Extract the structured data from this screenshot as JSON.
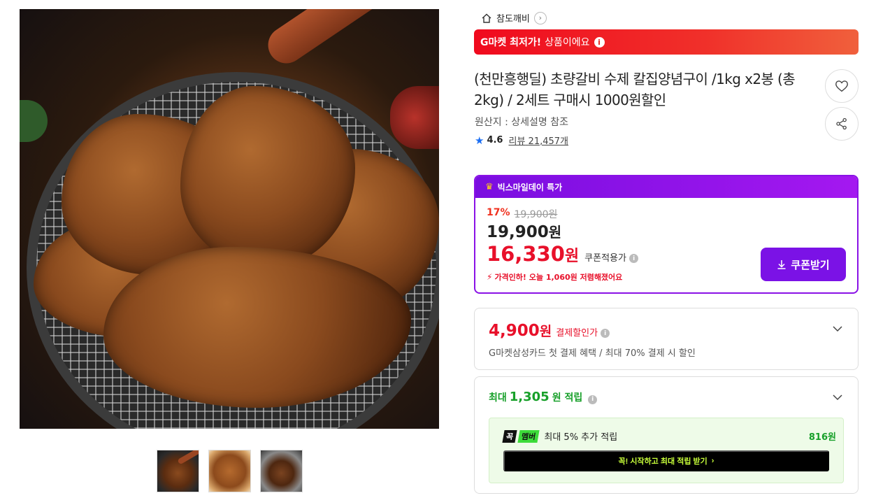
{
  "gallery": {
    "main_image_alt": "양념 소갈비구이 상품 이미지",
    "thumbnails": [
      "thumbnail-1",
      "thumbnail-2",
      "thumbnail-3"
    ]
  },
  "store": {
    "name": "참도깨비"
  },
  "banner": {
    "bold": "G마켓 최저가!",
    "rest": "상품이에요"
  },
  "product": {
    "title": "(천만흥행딜) 초량갈비 수제 칼집양념구이 /1kg x2봉 (총2kg) / 2세트 구매시 1000원할인",
    "origin": "원산지 : 상세설명 참조",
    "rating": "4.6",
    "review_label": "리뷰",
    "review_count": "21,457개"
  },
  "promo": {
    "badge": "빅스마일데이 특가",
    "discount_rate": "17%",
    "original_price": "19,900원",
    "price": "19,900",
    "price_unit": "원",
    "coupon_price": "16,330",
    "coupon_unit": "원",
    "coupon_label": "쿠폰적용가",
    "drop_notice": "가격인하! 오늘 1,060원 저렴해졌어요",
    "coupon_button": "쿠폰받기"
  },
  "payment": {
    "amount": "4,900",
    "unit": "원",
    "label": "결제할인가",
    "description": "G마켓삼성카드 첫 결제 혜택 / 최대 70% 결제 시 할인"
  },
  "points": {
    "prefix": "최대",
    "amount": "1,305",
    "suffix": "원 적립",
    "member_logo_a": "꼭",
    "member_logo_b": "멤버",
    "member_text": "최대 5% 추가 적립",
    "member_won": "816원",
    "start_button": "꼭! 시작하고 최대 적립 받기"
  },
  "icons": {
    "home": "home-icon",
    "heart": "heart-icon",
    "share": "share-icon",
    "download": "download-icon",
    "chevron_down": "chevron-down-icon"
  },
  "colors": {
    "banner_red": "#f00a1e",
    "promo_purple": "#7b12e6",
    "price_red": "#e8102a",
    "points_green": "#18a02a",
    "rating_blue": "#1b6ef3"
  }
}
